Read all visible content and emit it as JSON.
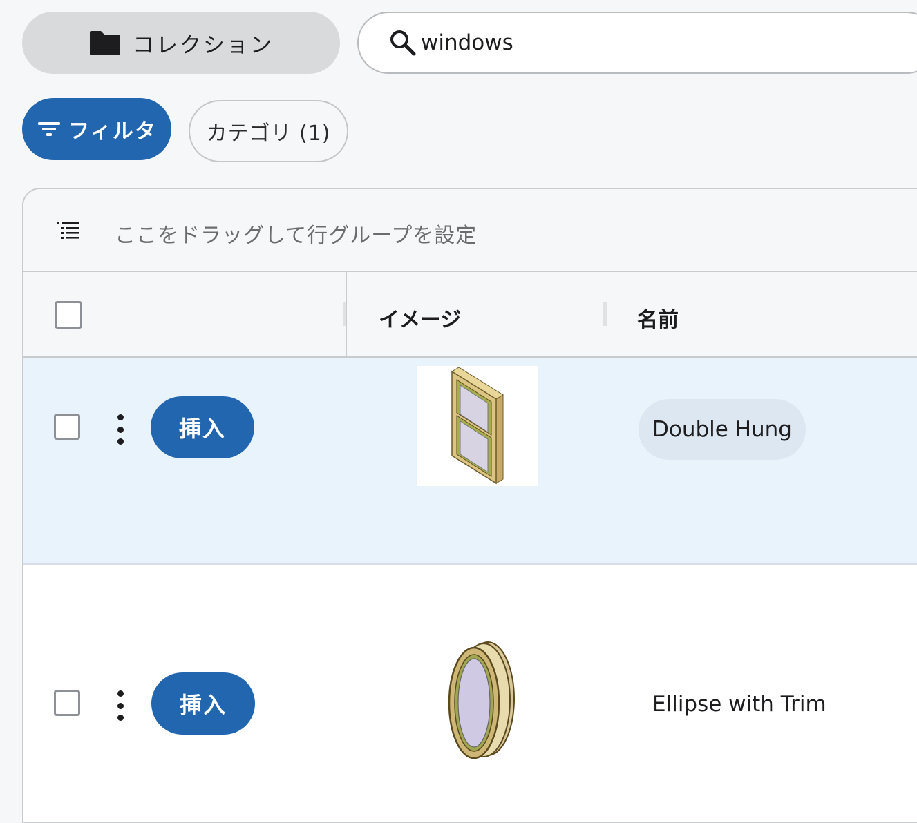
{
  "toolbar": {
    "collection_label": "コレクション",
    "search_value": "windows"
  },
  "filters": {
    "filter_label": "フィルタ",
    "category_chip": "カテゴリ (1)"
  },
  "grid": {
    "group_panel_hint": "ここをドラッグして行グループを設定",
    "columns": {
      "image": "イメージ",
      "name": "名前"
    },
    "rows": [
      {
        "insert_label": "挿入",
        "name": "Double Hung",
        "selected_highlight": true
      },
      {
        "insert_label": "挿入",
        "name": "Ellipse with Trim",
        "selected_highlight": false
      }
    ]
  },
  "colors": {
    "accent": "#2266b0",
    "row_highlight": "#e8f3fc",
    "page_bg": "#f6f7f8"
  },
  "icons": [
    "folder-icon",
    "search-icon",
    "filter-icon",
    "group-list-icon",
    "kebab-menu-icon"
  ]
}
